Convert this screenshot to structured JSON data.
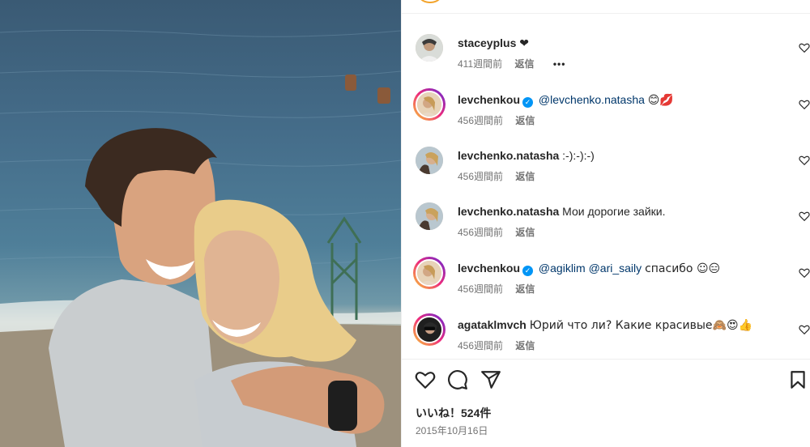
{
  "comments": [
    {
      "username": "staceyplus",
      "verified": false,
      "text": "❤",
      "mentions": [],
      "time": "411週間前",
      "reply": "返信",
      "more": "•••"
    },
    {
      "username": "levchenkou",
      "verified": true,
      "mentions": [
        "@levchenko.natasha"
      ],
      "text": "😊💋",
      "time": "456週間前",
      "reply": "返信"
    },
    {
      "username": "levchenko.natasha",
      "verified": false,
      "mentions": [],
      "text": ":-):-):-)",
      "time": "456週間前",
      "reply": "返信"
    },
    {
      "username": "levchenko.natasha",
      "verified": false,
      "mentions": [],
      "text": "Мои дорогие зайки.",
      "time": "456週間前",
      "reply": "返信"
    },
    {
      "username": "levchenkou",
      "verified": true,
      "mentions": [
        "@agiklim",
        "@ari_saily"
      ],
      "text": "спасибо ☺😑",
      "time": "456週間前",
      "reply": "返信"
    },
    {
      "username": "agataklmvch",
      "verified": false,
      "mentions": [],
      "text": "Юрий что ли? Какие красивые🙈😍👍",
      "time": "456週間前",
      "reply": "返信"
    }
  ],
  "likes_label": "いいね！524件",
  "date": "2015年10月16日",
  "colors": {
    "link": "#00376b",
    "verified": "#0095f6",
    "muted": "#737373"
  },
  "icons": [
    "heart-icon",
    "comment-icon",
    "share-icon",
    "bookmark-icon"
  ]
}
